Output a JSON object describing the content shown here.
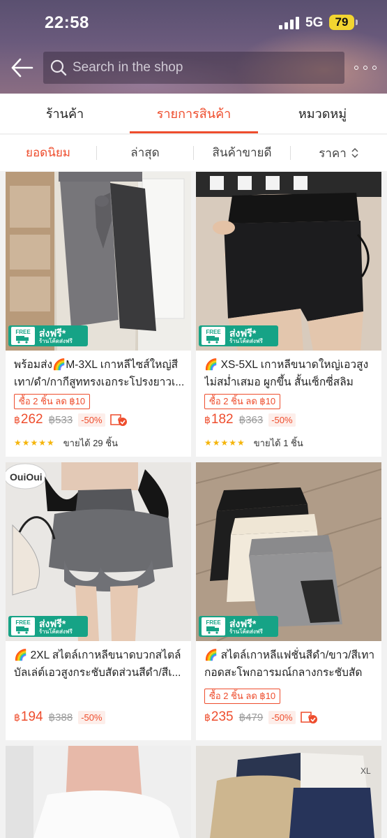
{
  "status_bar": {
    "time": "22:58",
    "network": "5G",
    "battery": "79"
  },
  "header": {
    "search_placeholder": "Search in the shop"
  },
  "tabs": [
    {
      "label": "ร้านค้า"
    },
    {
      "label": "รายการสินค้า"
    },
    {
      "label": "หมวดหมู่"
    }
  ],
  "sort": [
    {
      "label": "ยอดนิยม"
    },
    {
      "label": "ล่าสุด"
    },
    {
      "label": "สินค้าขายดี"
    },
    {
      "label": "ราคา"
    }
  ],
  "badge": {
    "free_label": "ส่งฟรี*",
    "free_sub": "ร้านโค้ดส่งฟรี",
    "truck_label": "FREE"
  },
  "products": [
    {
      "title": "พร้อมส่ง🌈M-3XL เกาหลีไซส์ใหญ่สีเทา/ดำ/กากีสูททรงเอกระโปรงยาวเ...",
      "promo": "ซื้อ 2 ชิ้น ลด ฿10",
      "currency": "฿",
      "price": "262",
      "old_price": "฿533",
      "discount": "-50%",
      "stars": "★★★★★",
      "rating": 4.5,
      "sold": "ขายได้ 29 ชิ้น"
    },
    {
      "title": "🌈 XS-5XL เกาหลีขนาดใหญ่เอวสูงไม่สม่ำเสมอ ผูกขึ้น สั้นเซ็กซี่สลิมสะโ...",
      "promo": "ซื้อ 2 ชิ้น ลด ฿10",
      "currency": "฿",
      "price": "182",
      "old_price": "฿363",
      "discount": "-50%",
      "stars": "★★★★★",
      "rating": 5,
      "sold": "ขายได้ 1 ชิ้น"
    },
    {
      "title": "🌈 2XL สไตล์เกาหลีขนาดบวกสไตล์บัลเล่ต์เอวสูงกระชับสัดส่วนสีดำ/สีเ...",
      "currency": "฿",
      "price": "194",
      "old_price": "฿388",
      "discount": "-50%"
    },
    {
      "title": "🌈 สไตล์เกาหลีแฟชั่นสีดำ/ขาว/สีเทากอดสะโพกอารมณ์กลางกระชับสัดส่...",
      "promo": "ซื้อ 2 ชิ้น ลด ฿10",
      "currency": "฿",
      "price": "235",
      "old_price": "฿479",
      "discount": "-50%"
    }
  ]
}
